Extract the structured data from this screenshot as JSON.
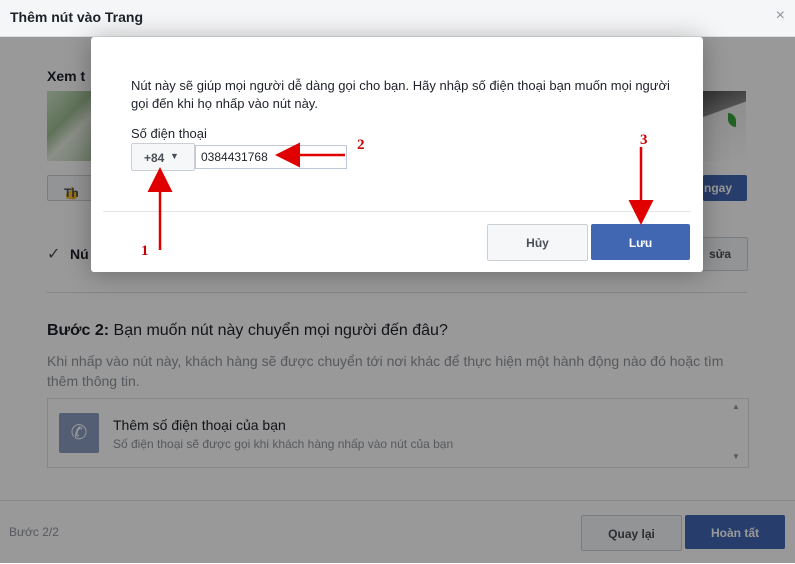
{
  "header": {
    "title": "Thêm nút vào Trang",
    "close": "×"
  },
  "background": {
    "preview_title": "Xem t",
    "like_label": "Th",
    "action_label": "ngay",
    "step1_label": "Nú",
    "edit_label": "sửa",
    "step2_prefix": "Bước 2:",
    "step2_question": " Bạn muốn nút này chuyển mọi người đến đâu?",
    "step2_desc": "Khi nhấp vào nút này, khách hàng sẽ được chuyển tới nơi khác để thực hiện một hành động nào đó hoặc tìm thêm thông tin.",
    "option_title": "Thêm số điện thoại của bạn",
    "option_desc": "Số điện thoại sẽ được gọi khi khách hàng nhấp vào nút của bạn",
    "step_count": "Bước 2/2",
    "back_label": "Quay lại",
    "done_label": "Hoàn tất"
  },
  "modal": {
    "description": "Nút này sẽ giúp mọi người dễ dàng gọi cho bạn. Hãy nhập số điện thoại bạn muốn mọi người gọi đến khi họ nhấp vào nút này.",
    "phone_label": "Số điện thoại",
    "country_code": "+84",
    "phone_value": "0384431768",
    "cancel_label": "Hủy",
    "save_label": "Lưu"
  },
  "annotations": [
    "1",
    "2",
    "3"
  ],
  "colors": {
    "accent": "#4267b2",
    "annotation": "#cc0000"
  },
  "icons": [
    "close-icon",
    "like-icon",
    "check-icon",
    "phone-icon",
    "caret-down-icon"
  ]
}
